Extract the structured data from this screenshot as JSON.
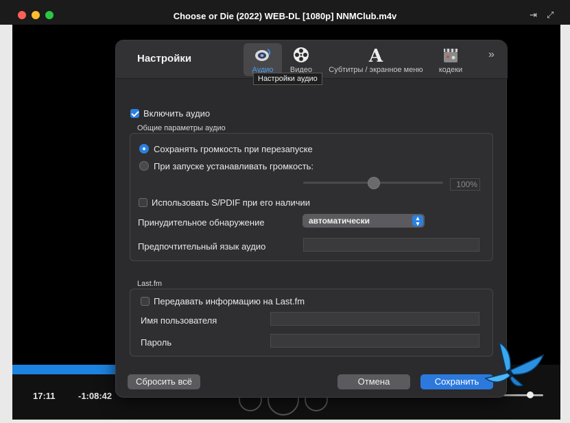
{
  "window": {
    "title": "Choose or Die (2022) WEB-DL [1080p] NNMClub.m4v",
    "pin_icon": "pin-icon",
    "fullscreen_icon": "fullscreen-icon"
  },
  "player": {
    "time_current": "17:11",
    "time_remaining": "-1:08:42",
    "progress_fraction": 0.19
  },
  "dialog": {
    "title": "Настройки",
    "tabs": [
      {
        "label": "Аудио",
        "icon": "speaker-icon",
        "active": true
      },
      {
        "label": "Видео",
        "icon": "film-reel-icon",
        "active": false
      },
      {
        "label": "Субтитры / экранное меню",
        "icon": "letter-a-icon",
        "active": false
      },
      {
        "label": "кодеки",
        "icon": "codec-clapper-icon",
        "active": false
      }
    ],
    "more_icon": "chevron-double-right-icon",
    "tooltip": "Настройки аудио",
    "enable_audio": {
      "label": "Включить аудио",
      "checked": true
    },
    "general_section": {
      "title": "Общие параметры аудио",
      "radio_keep_volume": {
        "label": "Сохранять громкость при перезапуске",
        "selected": true
      },
      "radio_set_volume": {
        "label": "При запуске устанавливать громкость:",
        "selected": false
      },
      "volume_value": "100%",
      "volume_fraction": 0.5,
      "spdif": {
        "label": "Использовать S/PDIF при его наличии",
        "checked": false
      },
      "forced_detection_label": "Принудительное обнаружение",
      "forced_detection_value": "автоматически",
      "preferred_language_label": "Предпочтительный язык аудио",
      "preferred_language_value": ""
    },
    "lastfm_section": {
      "title": "Last.fm",
      "send_info": {
        "label": "Передавать информацию на Last.fm",
        "checked": false
      },
      "username_label": "Имя пользователя",
      "username_value": "",
      "password_label": "Пароль",
      "password_value": ""
    },
    "buttons": {
      "reset": "Сбросить всё",
      "cancel": "Отмена",
      "save": "Сохранить"
    }
  },
  "colors": {
    "accent": "#2b7fe0",
    "progress": "#1d83e0",
    "dialog_bg": "#2b2b2d"
  }
}
